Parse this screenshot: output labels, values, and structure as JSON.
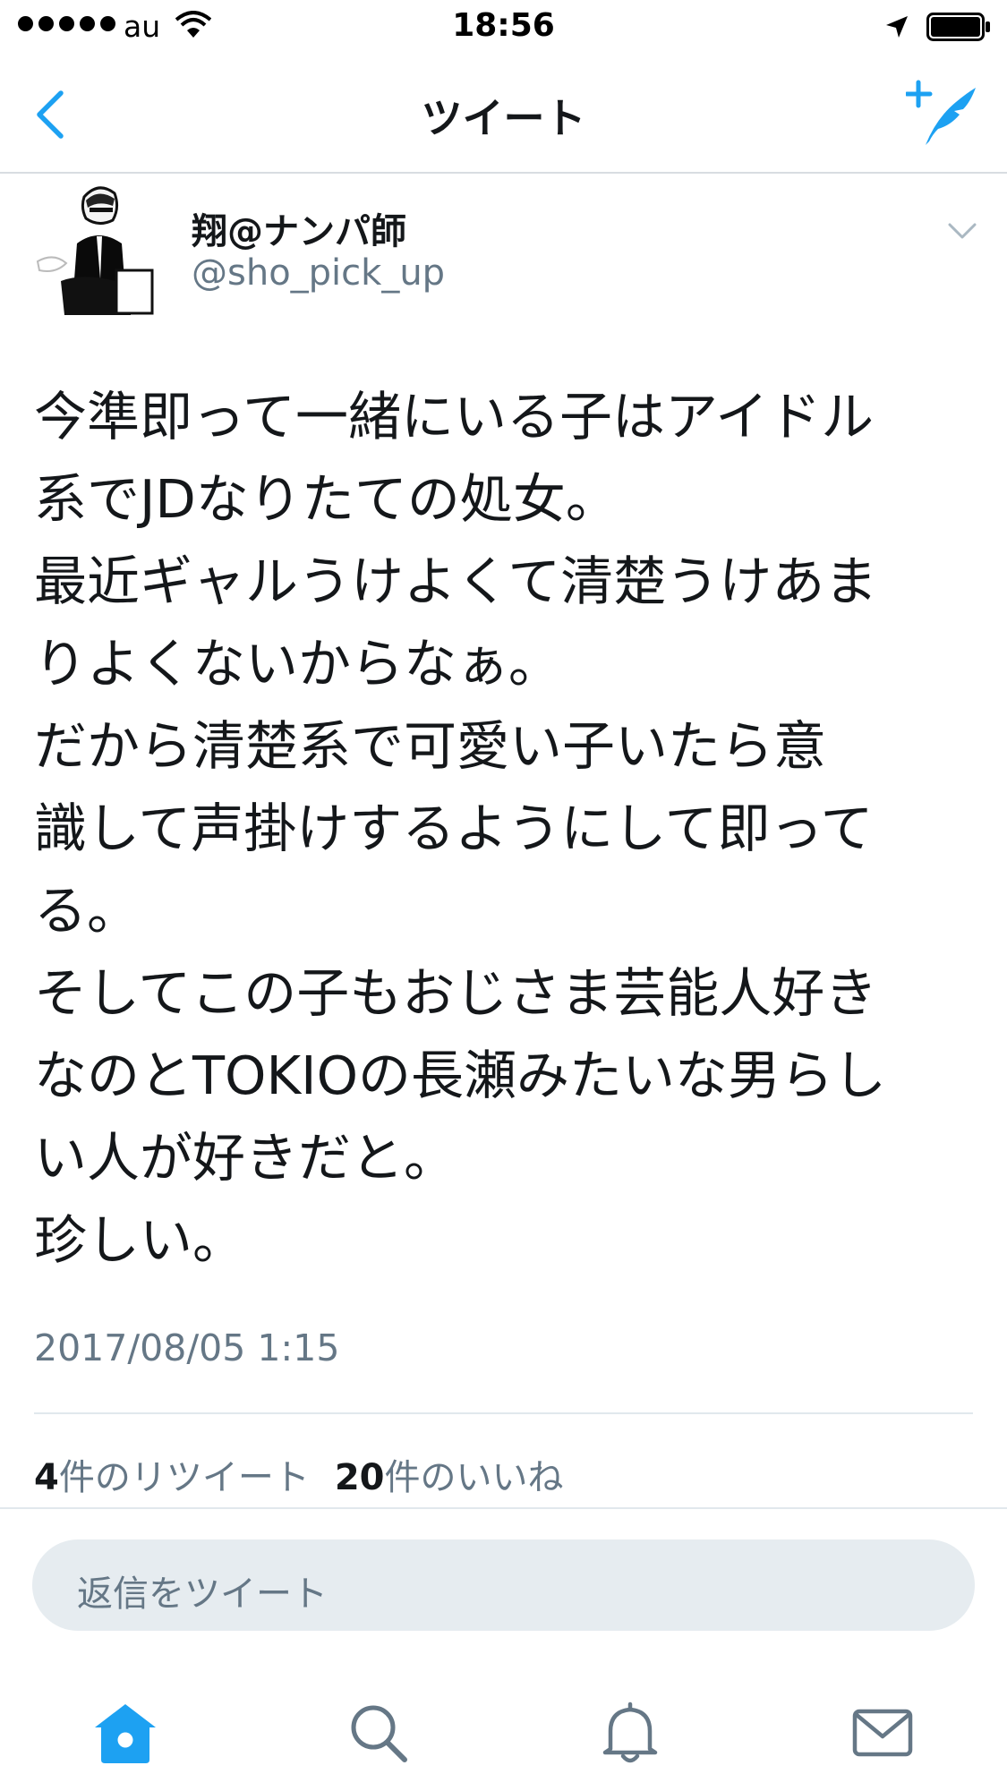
{
  "status_bar": {
    "carrier": "au",
    "time": "18:56"
  },
  "nav": {
    "title": "ツイート"
  },
  "tweet": {
    "display_name": "翔@ナンパ師",
    "screen_name": "@sho_pick_up",
    "lines": [
      "今準即って一緒にいる子はアイドル",
      "系でJDなりたての処女。",
      "最近ギャルうけよくて清楚うけあま",
      "りよくないからなぁ。",
      "だから清楚系で可愛い子いたら意",
      "識して声掛けするようにして即って",
      "る。",
      "そしてこの子もおじさま芸能人好き",
      "なのとTOKIOの長瀬みたいな男らし",
      "い人が好きだと。",
      "珍しい。"
    ],
    "timestamp": "2017/08/05 1:15",
    "retweet_count": "4",
    "retweet_label": "件のリツイート",
    "like_count": "20",
    "like_label": "件のいいね"
  },
  "reply": {
    "placeholder": "返信をツイート"
  },
  "colors": {
    "accent": "#1da1f2",
    "text": "#14171a",
    "muted": "#657786",
    "reply_bg": "#e6ecf0",
    "divider": "#e1e8ed"
  },
  "icons": {
    "back": "chevron-left-icon",
    "compose": "compose-tweet-icon",
    "caret": "chevron-down-icon",
    "tabs": [
      "home-icon",
      "search-icon",
      "bell-icon",
      "mail-icon"
    ]
  }
}
